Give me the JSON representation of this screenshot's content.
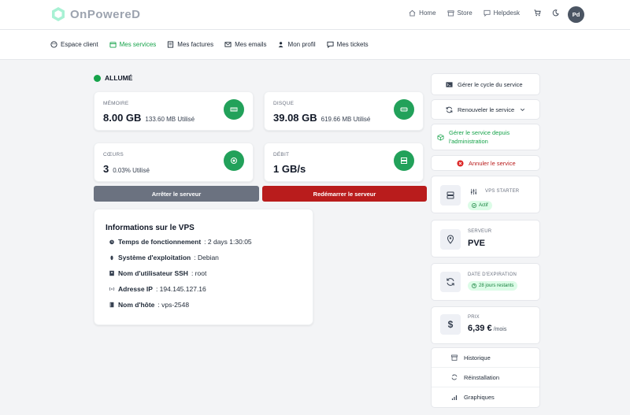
{
  "brand": {
    "name": "OnPowereD"
  },
  "topnav": {
    "home": "Home",
    "store": "Store",
    "helpdesk": "Helpdesk",
    "avatar": "Pd"
  },
  "subnav": [
    "Espace client",
    "Mes services",
    "Mes factures",
    "Mes emails",
    "Mon profil",
    "Mes tickets"
  ],
  "status": "ALLUMÉ",
  "stats": {
    "memory": {
      "label": "MÉMOIRE",
      "value": "8.00 GB",
      "sub": "133.60 MB Utilisé"
    },
    "disk": {
      "label": "DISQUE",
      "value": "39.08 GB",
      "sub": "619.66 MB Utilisé"
    },
    "cores": {
      "label": "CŒURS",
      "value": "3",
      "sub": "0.03% Utilisé"
    },
    "bandwidth": {
      "label": "DÉBIT",
      "value": "1 GB/s",
      "sub": ""
    }
  },
  "actions": {
    "stop": "Arrêter le serveur",
    "restart": "Redémarrer le serveur"
  },
  "info": {
    "title": "Informations sur le VPS",
    "uptime_label": "Temps de fonctionnement",
    "uptime": " : 2 days 1:30:05",
    "os_label": "Système d'exploitation",
    "os": " : Debian",
    "ssh_label": "Nom d'utilisateur SSH",
    "ssh": " : root",
    "ip_label": "Adresse IP",
    "ip": " : 194.145.127.16",
    "host_label": "Nom d'hôte",
    "host": " : vps-2548"
  },
  "sidebar": {
    "lifecycle": "Gérer le cycle du service",
    "renew": "Renouveler le service",
    "admin": "Gérer le service depuis l'administration",
    "cancel": "Annuler le service",
    "plan": {
      "name": "VPS STARTER",
      "status": "Actif"
    },
    "server": {
      "label": "SERVEUR",
      "value": "PVE"
    },
    "expiry": {
      "label": "DATE D'EXPIRATION",
      "value": "28 jours restants"
    },
    "price": {
      "label": "PRIX",
      "value": "6,39 €",
      "period": "/mois"
    },
    "menu": [
      "Historique",
      "Réinstallation",
      "Graphiques"
    ]
  },
  "colors": {
    "accent": "#16a34a",
    "danger": "#b91c1c",
    "muted_btn": "#6b7280"
  }
}
